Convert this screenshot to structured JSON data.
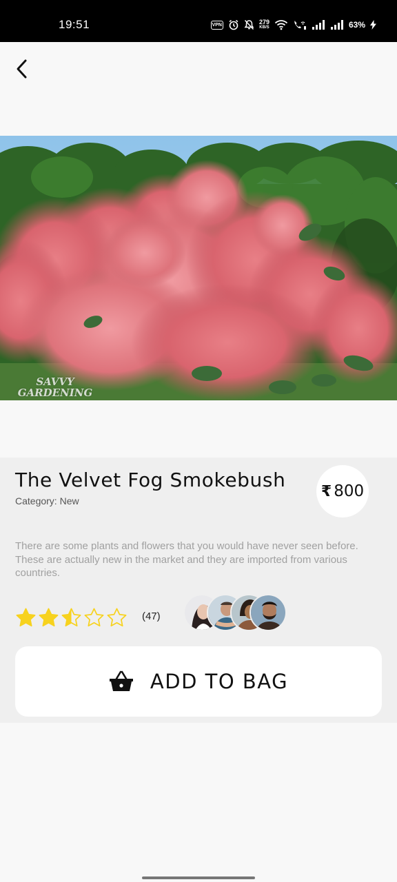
{
  "status_bar": {
    "time": "19:51",
    "vpn": "VPN",
    "speed_value": "279",
    "speed_unit": "KB/S",
    "battery": "63%"
  },
  "nav": {
    "back_icon": "chevron-left-icon"
  },
  "hero": {
    "watermark_line1": "SAVVY",
    "watermark_line2": "GARDENING"
  },
  "product": {
    "title": "The Velvet Fog Smokebush",
    "category": "Category: New",
    "currency_symbol": "₹",
    "price": "800",
    "description": "There are some plants and flowers that you would have never seen before. These are actually new in the market and they are imported from various countries.",
    "rating": 2.5,
    "rating_max": 5,
    "review_count": "(47)",
    "star_color": "#f7d21e"
  },
  "cta": {
    "label": "ADD TO BAG",
    "icon": "basket-icon"
  }
}
